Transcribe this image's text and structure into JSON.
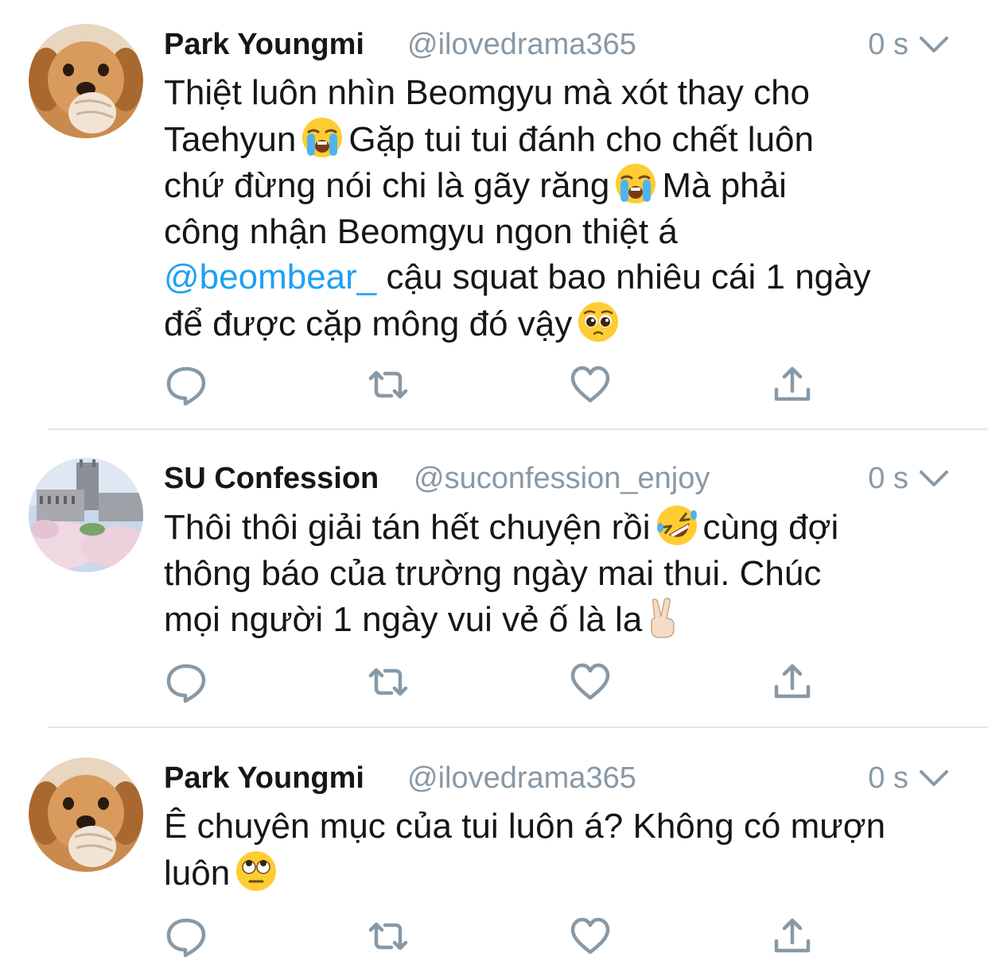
{
  "tweets": [
    {
      "name": "Park Youngmi",
      "handle": "@ilovedrama365",
      "time": "0 s",
      "line1": "Thiệt luôn nhìn Beomgyu mà xót thay cho",
      "line2a": "Taehyun",
      "line2b": "Gặp tui tui đánh cho chết luôn",
      "line3a": "chứ đừng nói chi là gãy răng",
      "line3b": "Mà phải",
      "line4": "công nhận Beomgyu ngon thiệt á",
      "mention": "@beombear_",
      "line5": "cậu squat bao nhiêu cái 1 ngày",
      "line6": "để được cặp mông đó vậy",
      "emojis": [
        "loudly-crying-face",
        "loudly-crying-face",
        "pleading-face"
      ]
    },
    {
      "name": "SU Confession",
      "handle": "@suconfession_enjoy",
      "time": "0 s",
      "line1a": "Thôi thôi giải tán hết chuyện rồi",
      "line1b": "cùng đợi",
      "line2": "thông báo của trường ngày mai thui. Chúc",
      "line3": "mọi người 1 ngày vui vẻ ố là la",
      "emojis": [
        "rolling-on-floor-laughing-face",
        "victory-hand"
      ]
    },
    {
      "name": "Park Youngmi",
      "handle": "@ilovedrama365",
      "time": "0 s",
      "line1": "Ê chuyên mục của tui luôn á? Không có mượn",
      "line2": "luôn",
      "emojis": [
        "face-with-rolling-eyes"
      ]
    }
  ],
  "actions": [
    "reply-icon",
    "retweet-icon",
    "like-icon",
    "share-icon"
  ],
  "colors": {
    "text": "#14171a",
    "secondary": "#8899a6",
    "link": "#1da1f2",
    "divider": "#e1e8ed",
    "icon": "#8899a6"
  }
}
